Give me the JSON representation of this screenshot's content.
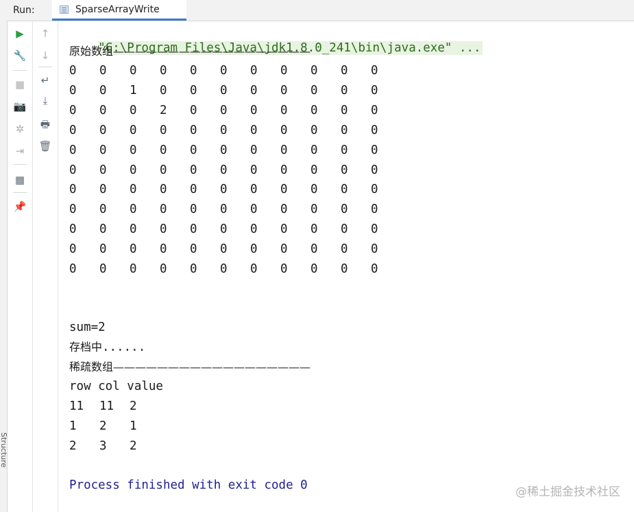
{
  "run_panel": {
    "label": "Run:",
    "tab_title": "SparseArrayWrite",
    "side_strip_label": "Structure"
  },
  "toolbar_left": [
    {
      "name": "rerun-icon",
      "glyph": "▶",
      "color": "#2e9e3f"
    },
    {
      "name": "wrench-icon",
      "glyph": "🔧",
      "color": "#5d6b77"
    },
    {
      "name": "stop-icon",
      "glyph": "■",
      "color": "#c8c8c8"
    },
    {
      "name": "camera-icon",
      "glyph": "📷",
      "color": "#b0b0b0"
    },
    {
      "name": "debug-bug-icon",
      "glyph": "✲",
      "color": "#b0b0b0"
    },
    {
      "name": "exit-icon",
      "glyph": "⇥",
      "color": "#b0b0b0"
    },
    {
      "name": "layout-icon",
      "glyph": "▦",
      "color": "#5d6b77"
    },
    {
      "name": "pin-icon",
      "glyph": "📌",
      "color": "#5d6b77"
    }
  ],
  "toolbar_right": [
    {
      "name": "up-arrow-icon",
      "glyph": "↑",
      "color": "#b0b0b0"
    },
    {
      "name": "down-arrow-icon",
      "glyph": "↓",
      "color": "#b0b0b0"
    },
    {
      "name": "soft-wrap-icon",
      "glyph": "↵",
      "color": "#5d6b77"
    },
    {
      "name": "scroll-to-end-icon",
      "glyph": "⤓",
      "color": "#5d6b77"
    },
    {
      "name": "print-icon",
      "glyph": "🖶",
      "color": "#5d6b77"
    },
    {
      "name": "trash-icon",
      "glyph": "🗑",
      "color": "#5d6b77"
    }
  ],
  "console": {
    "command": "\"C:\\Program Files\\Java\\jdk1.8.0_241\\bin\\java.exe\" ...",
    "original_header": "原始数组——————————————————",
    "original_array": [
      [
        "0",
        "0",
        "0",
        "0",
        "0",
        "0",
        "0",
        "0",
        "0",
        "0",
        "0"
      ],
      [
        "0",
        "0",
        "1",
        "0",
        "0",
        "0",
        "0",
        "0",
        "0",
        "0",
        "0"
      ],
      [
        "0",
        "0",
        "0",
        "2",
        "0",
        "0",
        "0",
        "0",
        "0",
        "0",
        "0"
      ],
      [
        "0",
        "0",
        "0",
        "0",
        "0",
        "0",
        "0",
        "0",
        "0",
        "0",
        "0"
      ],
      [
        "0",
        "0",
        "0",
        "0",
        "0",
        "0",
        "0",
        "0",
        "0",
        "0",
        "0"
      ],
      [
        "0",
        "0",
        "0",
        "0",
        "0",
        "0",
        "0",
        "0",
        "0",
        "0",
        "0"
      ],
      [
        "0",
        "0",
        "0",
        "0",
        "0",
        "0",
        "0",
        "0",
        "0",
        "0",
        "0"
      ],
      [
        "0",
        "0",
        "0",
        "0",
        "0",
        "0",
        "0",
        "0",
        "0",
        "0",
        "0"
      ],
      [
        "0",
        "0",
        "0",
        "0",
        "0",
        "0",
        "0",
        "0",
        "0",
        "0",
        "0"
      ],
      [
        "0",
        "0",
        "0",
        "0",
        "0",
        "0",
        "0",
        "0",
        "0",
        "0",
        "0"
      ],
      [
        "0",
        "0",
        "0",
        "0",
        "0",
        "0",
        "0",
        "0",
        "0",
        "0",
        "0"
      ]
    ],
    "sum_line": "sum=2",
    "saving_line": "存档中......",
    "sparse_header": "稀疏数组——————————————————",
    "sparse_columns": "row col value",
    "sparse_rows": [
      [
        "11",
        "11",
        "2"
      ],
      [
        "1",
        "2",
        "1"
      ],
      [
        "2",
        "3",
        "2"
      ]
    ],
    "finish_line": "Process finished with exit code 0"
  },
  "watermark": "@稀土掘金技术社区"
}
